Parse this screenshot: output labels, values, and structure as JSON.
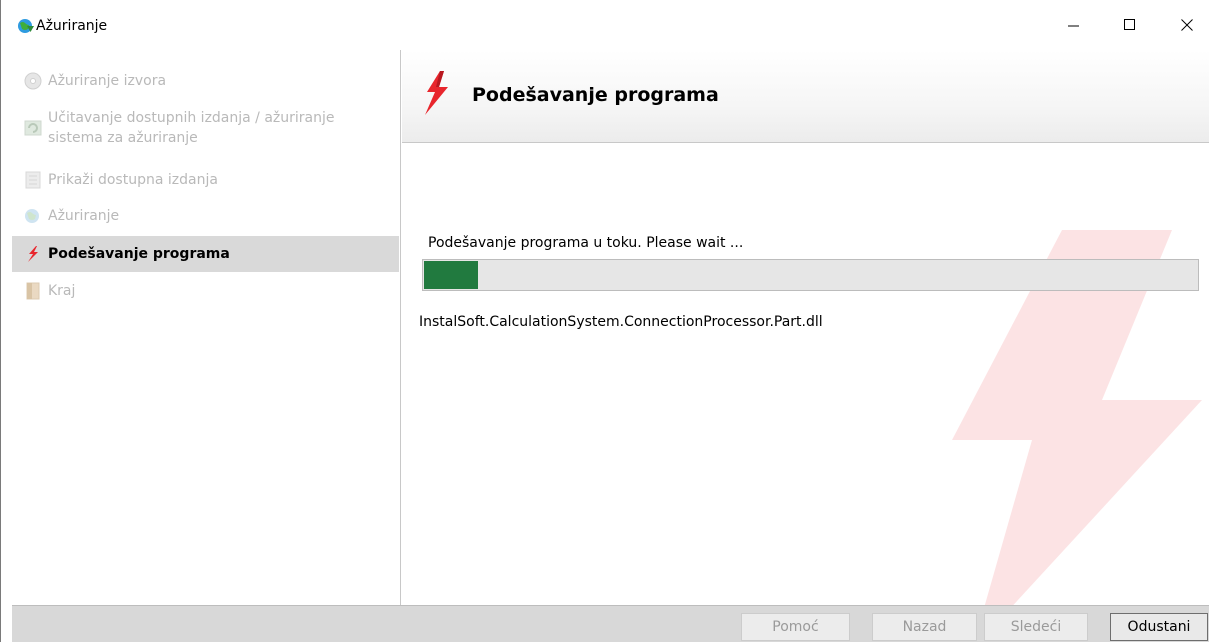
{
  "window": {
    "title": "Ažuriranje",
    "controls": {
      "minimize": "minimize-icon",
      "maximize": "maximize-icon",
      "close": "close-icon"
    }
  },
  "sidebar": {
    "steps": [
      {
        "label": "Ažuriranje izvora",
        "icon": "disc-icon",
        "state": "done"
      },
      {
        "label": "Učitavanje dostupnih izdanja / ažuriranje sistema za ažuriranje",
        "icon": "refresh-icon",
        "state": "done"
      },
      {
        "label": "Prikaži dostupna izdanja",
        "icon": "document-icon",
        "state": "done"
      },
      {
        "label": "Ažuriranje",
        "icon": "globe-update-icon",
        "state": "done"
      },
      {
        "label": "Podešavanje programa",
        "icon": "lightning-icon",
        "state": "active"
      },
      {
        "label": "Kraj",
        "icon": "exit-door-icon",
        "state": "pending"
      }
    ]
  },
  "main": {
    "header_title": "Podešavanje programa",
    "status_text": "Podešavanje programa u toku. Please wait ...",
    "progress": 0.07,
    "current_file": "InstalSoft.CalculationSystem.ConnectionProcessor.Part.dll"
  },
  "footer": {
    "help_label": "Pomoć",
    "back_label": "Nazad",
    "next_label": "Sledeći",
    "cancel_label": "Odustani"
  },
  "colors": {
    "progress_fill": "#217a3f",
    "accent_red": "#e8262d",
    "active_step_bg": "#d9d9d9",
    "footer_bg": "#d8d8d8"
  }
}
